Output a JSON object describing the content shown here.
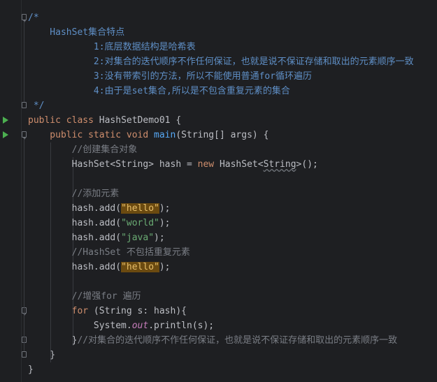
{
  "lines": [
    {
      "segments": [
        {
          "t": "/*",
          "c": "doc"
        }
      ]
    },
    {
      "segments": [
        {
          "t": "    HashSet集合特点",
          "c": "doc"
        }
      ]
    },
    {
      "segments": [
        {
          "t": "            1:底层数据结构是哈希表",
          "c": "doc"
        }
      ]
    },
    {
      "segments": [
        {
          "t": "            2:对集合的迭代顺序不作任何保证，也就是说不保证存储和取出的元素顺序一致",
          "c": "doc"
        }
      ]
    },
    {
      "segments": [
        {
          "t": "            3:没有带索引的方法，所以不能使用普通for循环遍历",
          "c": "doc"
        }
      ]
    },
    {
      "segments": [
        {
          "t": "            4:由于是set集合,所以是不包含重复元素的集合",
          "c": "doc"
        }
      ]
    },
    {
      "segments": [
        {
          "t": " */",
          "c": "doc"
        }
      ]
    },
    {
      "segments": [
        {
          "t": "public ",
          "c": "kw"
        },
        {
          "t": "class ",
          "c": "kw"
        },
        {
          "t": "HashSetDemo01 {",
          "c": ""
        }
      ]
    },
    {
      "segments": [
        {
          "t": "    public ",
          "c": "kw"
        },
        {
          "t": "static ",
          "c": "kw"
        },
        {
          "t": "void ",
          "c": "kw"
        },
        {
          "t": "main",
          "c": "fn"
        },
        {
          "t": "(String[] args) {",
          "c": ""
        }
      ]
    },
    {
      "segments": [
        {
          "t": "        //创建集合对象",
          "c": "comment"
        }
      ]
    },
    {
      "segments": [
        {
          "t": "        HashSet<String> hash = ",
          "c": ""
        },
        {
          "t": "new ",
          "c": "kw"
        },
        {
          "t": "HashSet<",
          "c": ""
        },
        {
          "t": "String",
          "c": "underline"
        },
        {
          "t": ">();",
          "c": ""
        }
      ]
    },
    {
      "segments": [
        {
          "t": "",
          "c": ""
        }
      ]
    },
    {
      "segments": [
        {
          "t": "        //添加元素",
          "c": "comment"
        }
      ]
    },
    {
      "segments": [
        {
          "t": "        hash.add(",
          "c": ""
        },
        {
          "t": "\"hello\"",
          "c": "hl"
        },
        {
          "t": ");",
          "c": ""
        }
      ]
    },
    {
      "segments": [
        {
          "t": "        hash.add(",
          "c": ""
        },
        {
          "t": "\"world\"",
          "c": "str"
        },
        {
          "t": ");",
          "c": ""
        }
      ]
    },
    {
      "segments": [
        {
          "t": "        hash.add(",
          "c": ""
        },
        {
          "t": "\"java\"",
          "c": "str"
        },
        {
          "t": ");",
          "c": ""
        }
      ]
    },
    {
      "segments": [
        {
          "t": "        //HashSet 不包括重复元素",
          "c": "comment"
        }
      ]
    },
    {
      "segments": [
        {
          "t": "        hash.add(",
          "c": ""
        },
        {
          "t": "\"hello\"",
          "c": "hl"
        },
        {
          "t": ");",
          "c": ""
        }
      ]
    },
    {
      "segments": [
        {
          "t": "",
          "c": ""
        }
      ]
    },
    {
      "segments": [
        {
          "t": "        //增强for 遍历",
          "c": "comment"
        }
      ]
    },
    {
      "segments": [
        {
          "t": "        for ",
          "c": "kw"
        },
        {
          "t": "(String s: hash){",
          "c": ""
        }
      ]
    },
    {
      "segments": [
        {
          "t": "            System.",
          "c": ""
        },
        {
          "t": "out",
          "c": "static-field"
        },
        {
          "t": ".println(s);",
          "c": ""
        }
      ]
    },
    {
      "segments": [
        {
          "t": "        }",
          "c": ""
        },
        {
          "t": "//对集合的迭代顺序不作任何保证，也就是说不保证存储和取出的元素顺序一致",
          "c": "comment"
        }
      ]
    },
    {
      "segments": [
        {
          "t": "    }",
          "c": ""
        }
      ]
    },
    {
      "segments": [
        {
          "t": "}",
          "c": ""
        }
      ]
    }
  ]
}
